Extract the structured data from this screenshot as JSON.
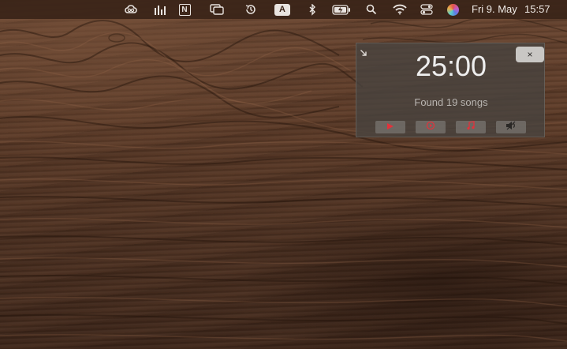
{
  "menubar": {
    "icons": [
      "creative-cloud-icon",
      "istat-bars-icon",
      "notion-icon",
      "window-switch-icon",
      "time-machine-icon",
      "input-source-icon",
      "bluetooth-icon",
      "battery-charging-icon",
      "spotlight-search-icon",
      "wifi-icon",
      "control-center-icon",
      "siri-icon"
    ],
    "input_source_label": "A",
    "notion_label": "N",
    "date": "Fri 9. May",
    "time": "15:57"
  },
  "timer_panel": {
    "time": "25:00",
    "status": "Found 19 songs",
    "close_label": "×",
    "controls": [
      "youtube-play-icon",
      "youtube-music-icon",
      "apple-music-icon",
      "speaker-icon"
    ],
    "accent_color": "#e2323b"
  }
}
